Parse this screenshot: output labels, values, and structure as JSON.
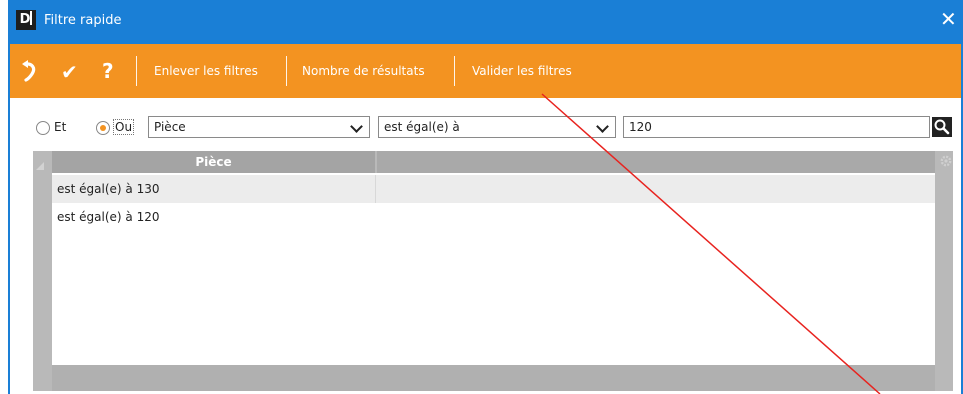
{
  "window": {
    "app_icon_letter": "D",
    "title": "Filtre rapide",
    "close_glyph": "✕"
  },
  "toolbar": {
    "undo_icon": "undo-arrow-icon",
    "check_glyph": "✔",
    "help_glyph": "?",
    "remove_filters": "Enlever les filtres",
    "result_count": "Nombre de résultats",
    "apply_filters": "Valider les filtres"
  },
  "filter": {
    "and_label": "Et",
    "or_label": "Ou",
    "selected_logic": "Ou",
    "field_value": "Pièce",
    "operator_value": "est égal(e) à",
    "search_value": "120"
  },
  "grid": {
    "columns": [
      "Pièce",
      ""
    ],
    "rows": [
      [
        "est égal(e) à 130",
        ""
      ],
      [
        "est égal(e) à 120",
        ""
      ]
    ]
  },
  "colors": {
    "titlebar": "#1a7fd6",
    "toolbar": "#f39321",
    "annotation_line": "#e8231f"
  }
}
